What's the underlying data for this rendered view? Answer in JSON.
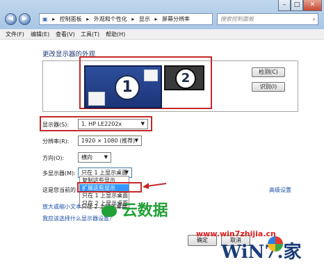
{
  "window": {
    "close_label": "✕",
    "max_label": "□",
    "min_label": "–"
  },
  "address": {
    "crumbs": [
      "控制面板",
      "外观和个性化",
      "显示",
      "屏幕分辨率"
    ],
    "search_placeholder": "搜索控制面板"
  },
  "menubar": [
    "文件(F)",
    "编辑(E)",
    "查看(V)",
    "工具(T)",
    "帮助(H)"
  ],
  "heading": "更改显示器的外观",
  "monitors": {
    "m1": "1",
    "m2": "2"
  },
  "buttons": {
    "detect": "检测(C)",
    "identify": "识别(I)",
    "ok": "确定",
    "cancel": "取消"
  },
  "display": {
    "label": "显示器(S):",
    "value": "1. HP LE2202x"
  },
  "resolution": {
    "label": "分辨率(R):",
    "value": "1920 × 1080 (推荐)"
  },
  "orientation": {
    "label": "方向(O):",
    "value": "横向"
  },
  "multi": {
    "label": "多显示器(M):",
    "value": "只在 1 上显示桌面",
    "options": [
      "复制这些显示",
      "扩展这些显示",
      "只在 1 上显示桌面",
      "只在 2 上显示桌面"
    ]
  },
  "current_display_text": "这是您当前的",
  "advanced_link": "高级设置",
  "link_text_size_prefix": "放大或缩小文本",
  "link_text_size_suffix": "只在 2 上显示桌面",
  "link_which_settings": "我应该选择什么显示器设置？",
  "watermark": {
    "site": "www.win7zhijia.cn",
    "data_brand": "云数据",
    "win7": "WiN7.家"
  },
  "colors": {
    "accent_red": "#c62828",
    "selected": "#3399ff",
    "link": "#1b4fa8"
  }
}
